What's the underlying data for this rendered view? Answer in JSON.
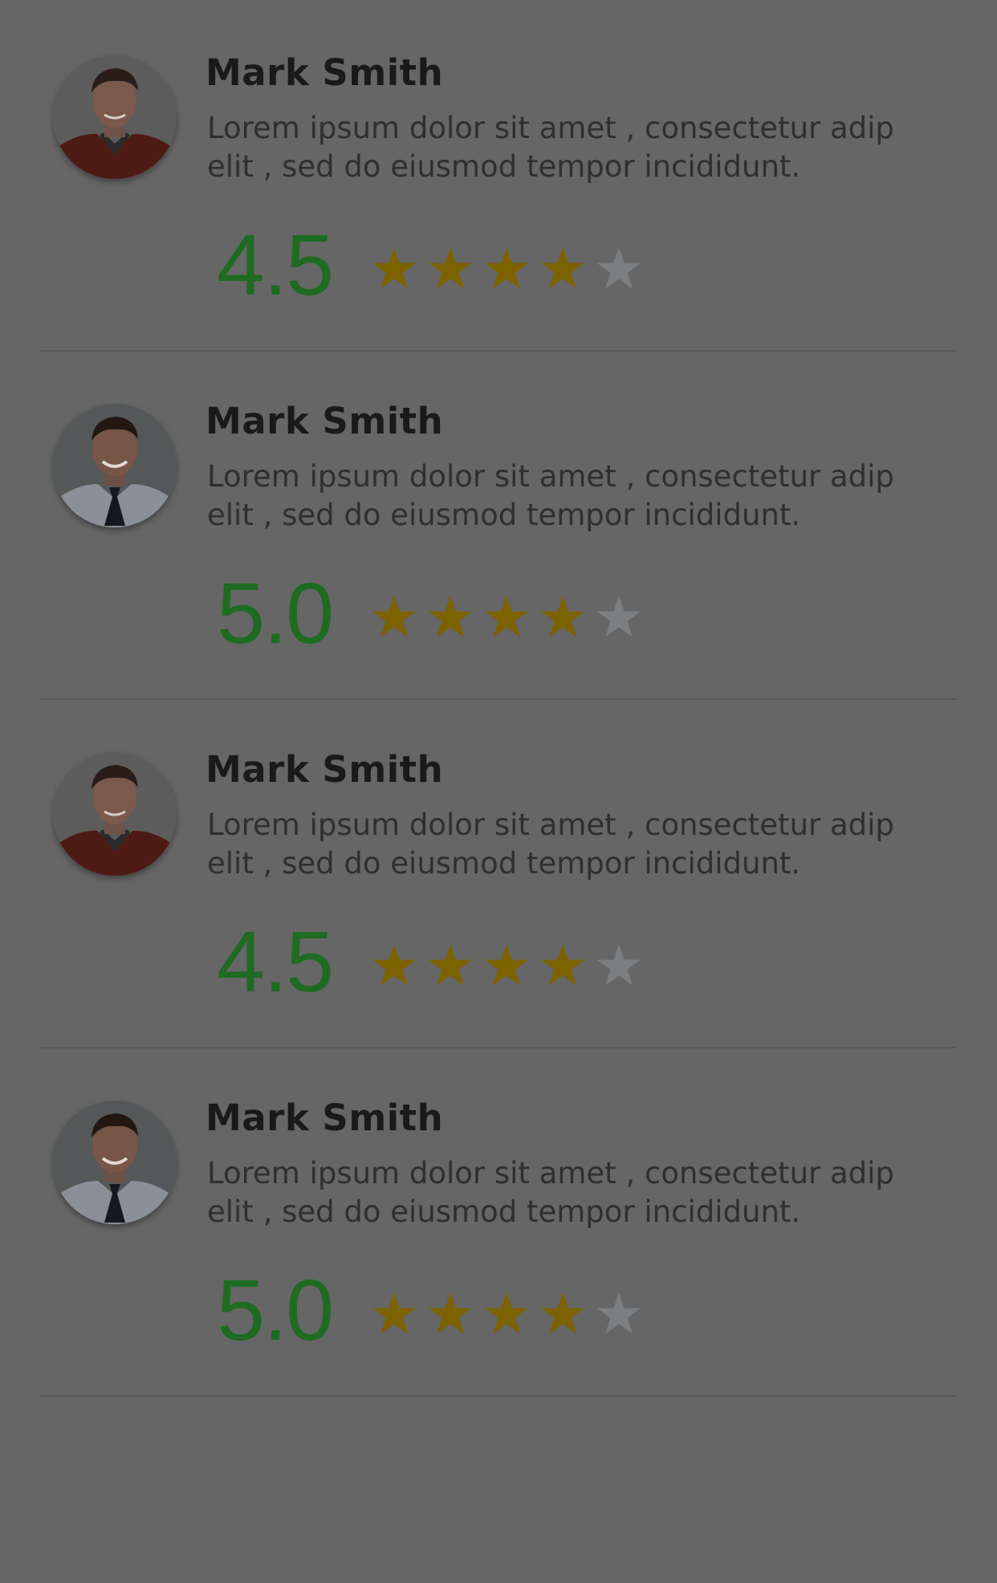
{
  "colors": {
    "background": "#666666",
    "score": "#1e6b22",
    "star_filled": "#7d6200",
    "star_empty": "#7b7f82",
    "name": "#1a1a1a",
    "body": "#2f2f2f"
  },
  "reviews": [
    {
      "name": "Mark Smith",
      "text": "Lorem ipsum dolor sit amet , consectetur adip elit , sed do eiusmod tempor incididunt.",
      "score": "4.5",
      "stars_filled": 4,
      "stars_total": 5,
      "avatar": "person-red-shirt"
    },
    {
      "name": "Mark Smith",
      "text": "Lorem ipsum dolor sit amet , consectetur adip elit , sed do eiusmod tempor incididunt.",
      "score": "5.0",
      "stars_filled": 4,
      "stars_total": 5,
      "avatar": "person-shirt-tie"
    },
    {
      "name": "Mark Smith",
      "text": "Lorem ipsum dolor sit amet , consectetur adip elit , sed do eiusmod tempor incididunt.",
      "score": "4.5",
      "stars_filled": 4,
      "stars_total": 5,
      "avatar": "person-red-shirt"
    },
    {
      "name": "Mark Smith",
      "text": "Lorem ipsum dolor sit amet , consectetur adip elit , sed do eiusmod tempor incididunt.",
      "score": "5.0",
      "stars_filled": 4,
      "stars_total": 5,
      "avatar": "person-shirt-tie"
    }
  ]
}
